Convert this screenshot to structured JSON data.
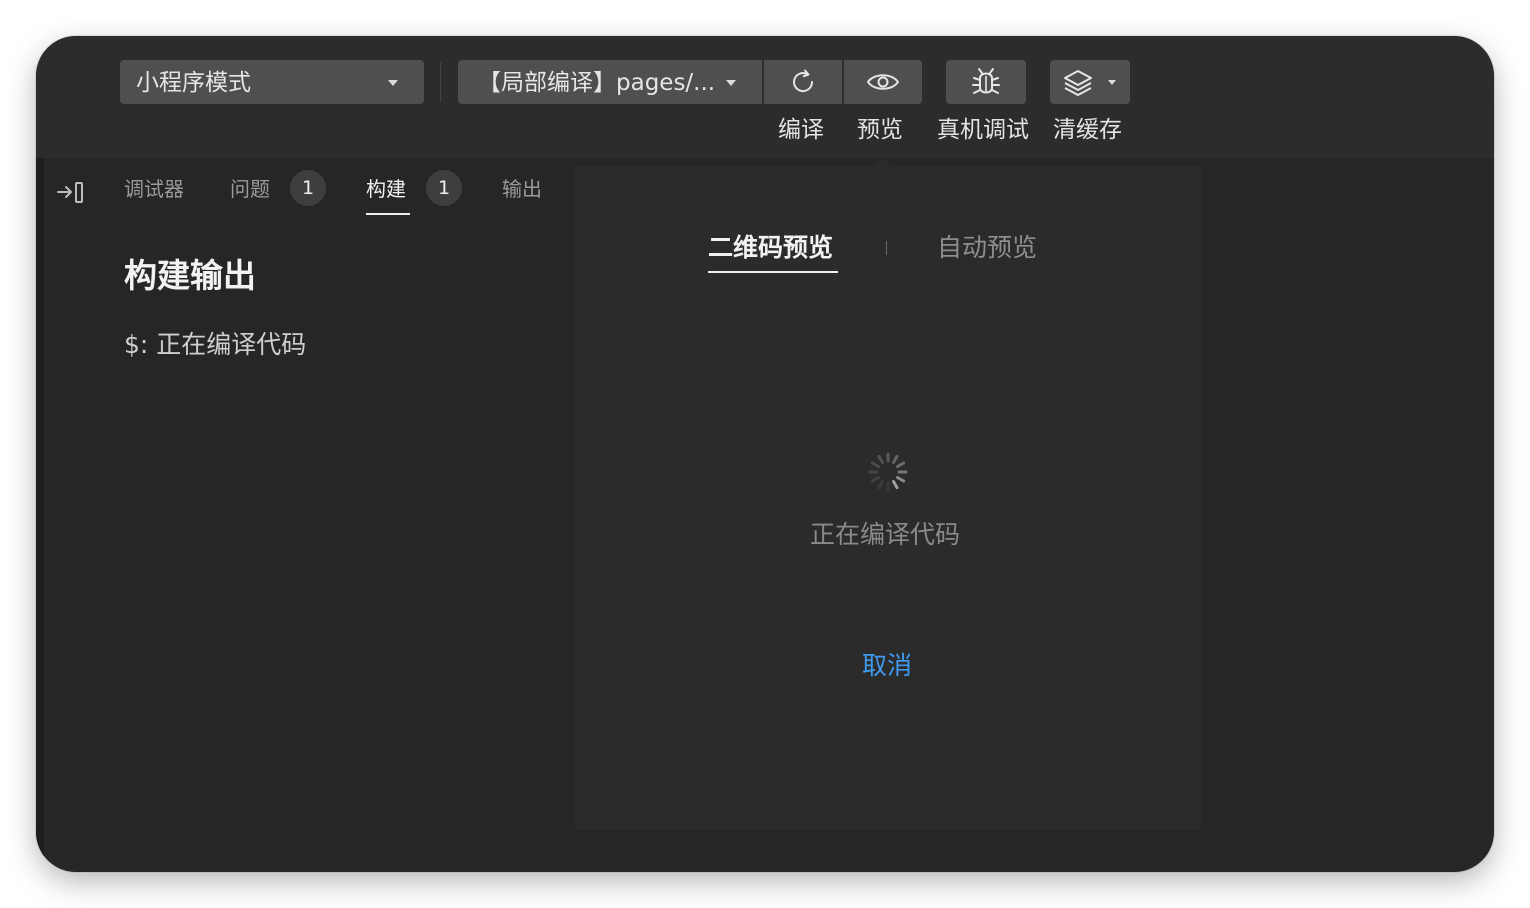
{
  "toolbar": {
    "mode_select": "小程序模式",
    "compile_select": "【局部编译】pages/...",
    "compile_label": "编译",
    "preview_label": "预览",
    "device_debug_label": "真机调试",
    "clear_cache_label": "清缓存"
  },
  "panel": {
    "tabs": [
      {
        "label": "调试器"
      },
      {
        "label": "问题",
        "badge": "1"
      },
      {
        "label": "构建",
        "badge": "1",
        "active": true
      },
      {
        "label": "输出"
      }
    ],
    "build_title": "构建输出",
    "build_line": "$: 正在编译代码"
  },
  "preview_popover": {
    "tabs": [
      "二维码预览",
      "自动预览"
    ],
    "active_tab": "二维码预览",
    "loading_text": "正在编译代码",
    "cancel_label": "取消"
  },
  "colors": {
    "background": "#262626",
    "toolbar": "#2c2c2c",
    "button": "#4f4f4f",
    "link": "#3f9bf0"
  },
  "icons": [
    "refresh-icon",
    "eye-icon",
    "bug-icon",
    "layers-icon",
    "collapse-panel-icon",
    "loading-spinner-icon"
  ]
}
